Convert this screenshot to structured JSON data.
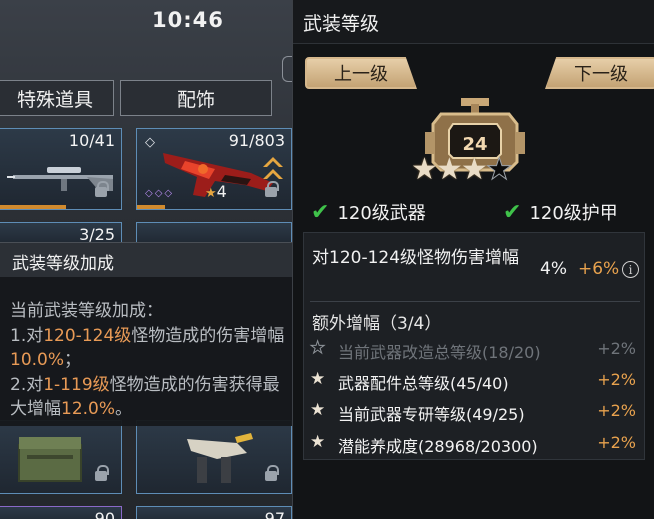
{
  "status_bar": {
    "time": "10:46"
  },
  "inventory": {
    "tabs": [
      "特殊道具",
      "配饰"
    ],
    "items": [
      {
        "count": "10/41",
        "progress": 0.55
      },
      {
        "count": "91/803",
        "progress": 0.18,
        "stars": "4"
      },
      {
        "count": "3/25"
      },
      {
        "count": ""
      },
      {
        "count": ""
      },
      {
        "count": ""
      },
      {
        "count": "90"
      },
      {
        "count": "97"
      }
    ]
  },
  "tooltip": {
    "title": "武装等级加成",
    "heading": "当前武装等级加成：",
    "line1_prefix": "1.对",
    "line1_range": "120-124级",
    "line1_mid": "怪物造成的伤害增幅",
    "line1_value": "10.0%",
    "line1_end": "；",
    "line2_prefix": "2.对",
    "line2_range": "1-119级",
    "line2_mid": "怪物造成的伤害获得最大增幅",
    "line2_value": "12.0%",
    "line2_end": "。"
  },
  "panel": {
    "title": "武装等级",
    "prev_label": "上一级",
    "next_label": "下一级",
    "level": "24",
    "stars_filled": 3,
    "stars_total": 4,
    "requirements": [
      "120级武器",
      "120级护甲"
    ],
    "damage_label": "对120-124级怪物伤害增幅",
    "damage_value": "4%",
    "damage_bonus": "+6%",
    "extra_title": "额外增幅（3/4）",
    "extra_rows": [
      {
        "label": "当前武器改造总等级(18/20)",
        "bonus": "+2%",
        "achieved": false
      },
      {
        "label": "武器配件总等级(45/40)",
        "bonus": "+2%",
        "achieved": true
      },
      {
        "label": "当前武器专研等级(49/25)",
        "bonus": "+2%",
        "achieved": true
      },
      {
        "label": "潜能养成度(28968/20300)",
        "bonus": "+2%",
        "achieved": true
      }
    ]
  },
  "colors": {
    "accent": "#e8a24e",
    "check": "#3fc24a",
    "button": "#d5b78c"
  }
}
